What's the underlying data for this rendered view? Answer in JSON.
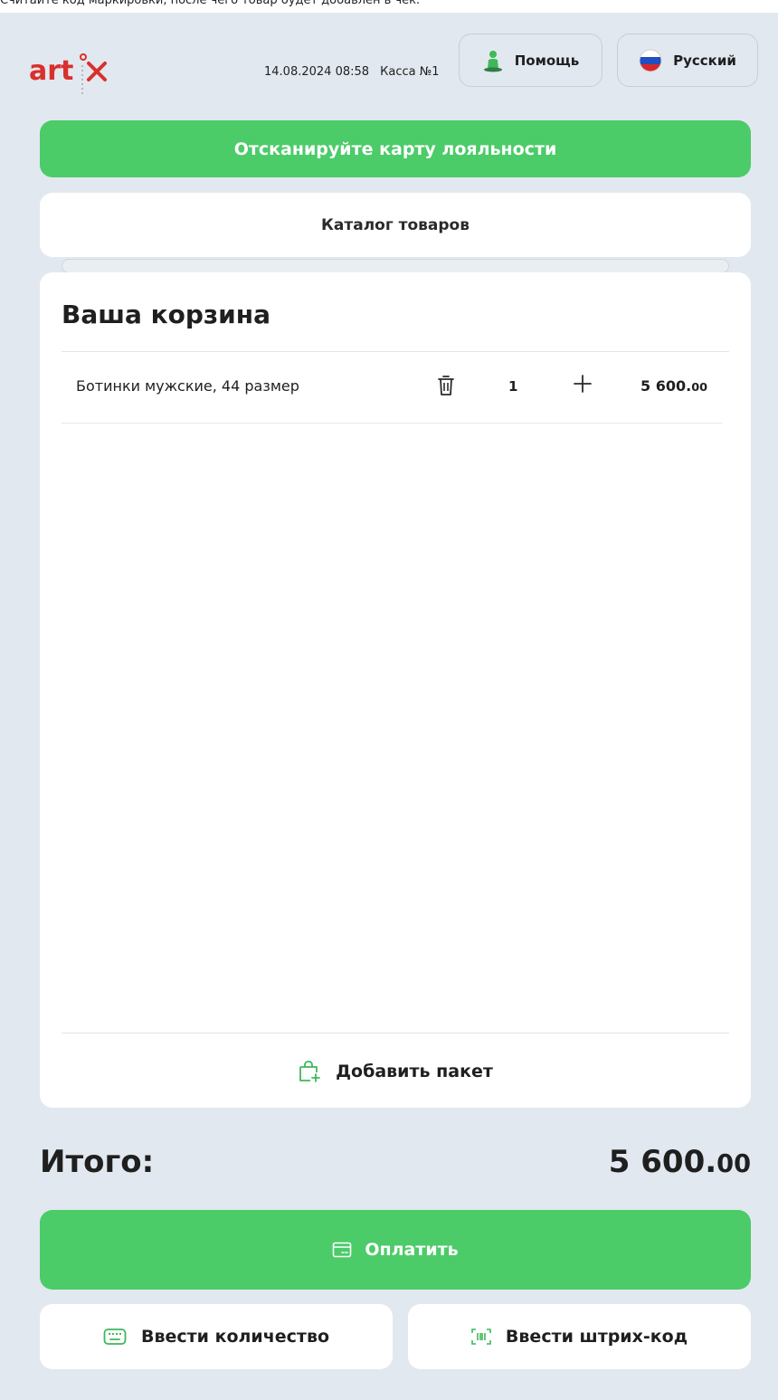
{
  "hint": "Считайте код маркировки, после чего товар будет добавлен в чек.",
  "header": {
    "logo_text": "artix",
    "datetime": "14.08.2024 08:58",
    "register": "Касса №1",
    "help_label": "Помощь",
    "language_label": "Русский"
  },
  "loyalty": {
    "label": "Отсканируйте карту лояльности"
  },
  "catalog": {
    "label": "Каталог товаров"
  },
  "cart": {
    "title": "Ваша корзина",
    "items": [
      {
        "name": "Ботинки мужские, 44 размер",
        "quantity": "1",
        "price_main": "5 600.",
        "price_cents": "00"
      }
    ],
    "add_bag_label": "Добавить пакет"
  },
  "total": {
    "label": "Итого:",
    "value_main": "5 600.",
    "value_cents": "00"
  },
  "actions": {
    "pay_label": "Оплатить",
    "enter_quantity_label": "Ввести количество",
    "enter_barcode_label": "Ввести штрих-код"
  },
  "colors": {
    "accent_green": "#4ccb69",
    "brand_red": "#d9302c",
    "background": "#e2e8ef"
  },
  "icons": {
    "help": "person-help-icon",
    "language": "flag-russia-icon",
    "delete": "trash-icon",
    "increase": "plus-icon",
    "bag": "bag-add-icon",
    "pay": "card-icon",
    "quantity": "keyboard-icon",
    "barcode": "barcode-icon"
  }
}
